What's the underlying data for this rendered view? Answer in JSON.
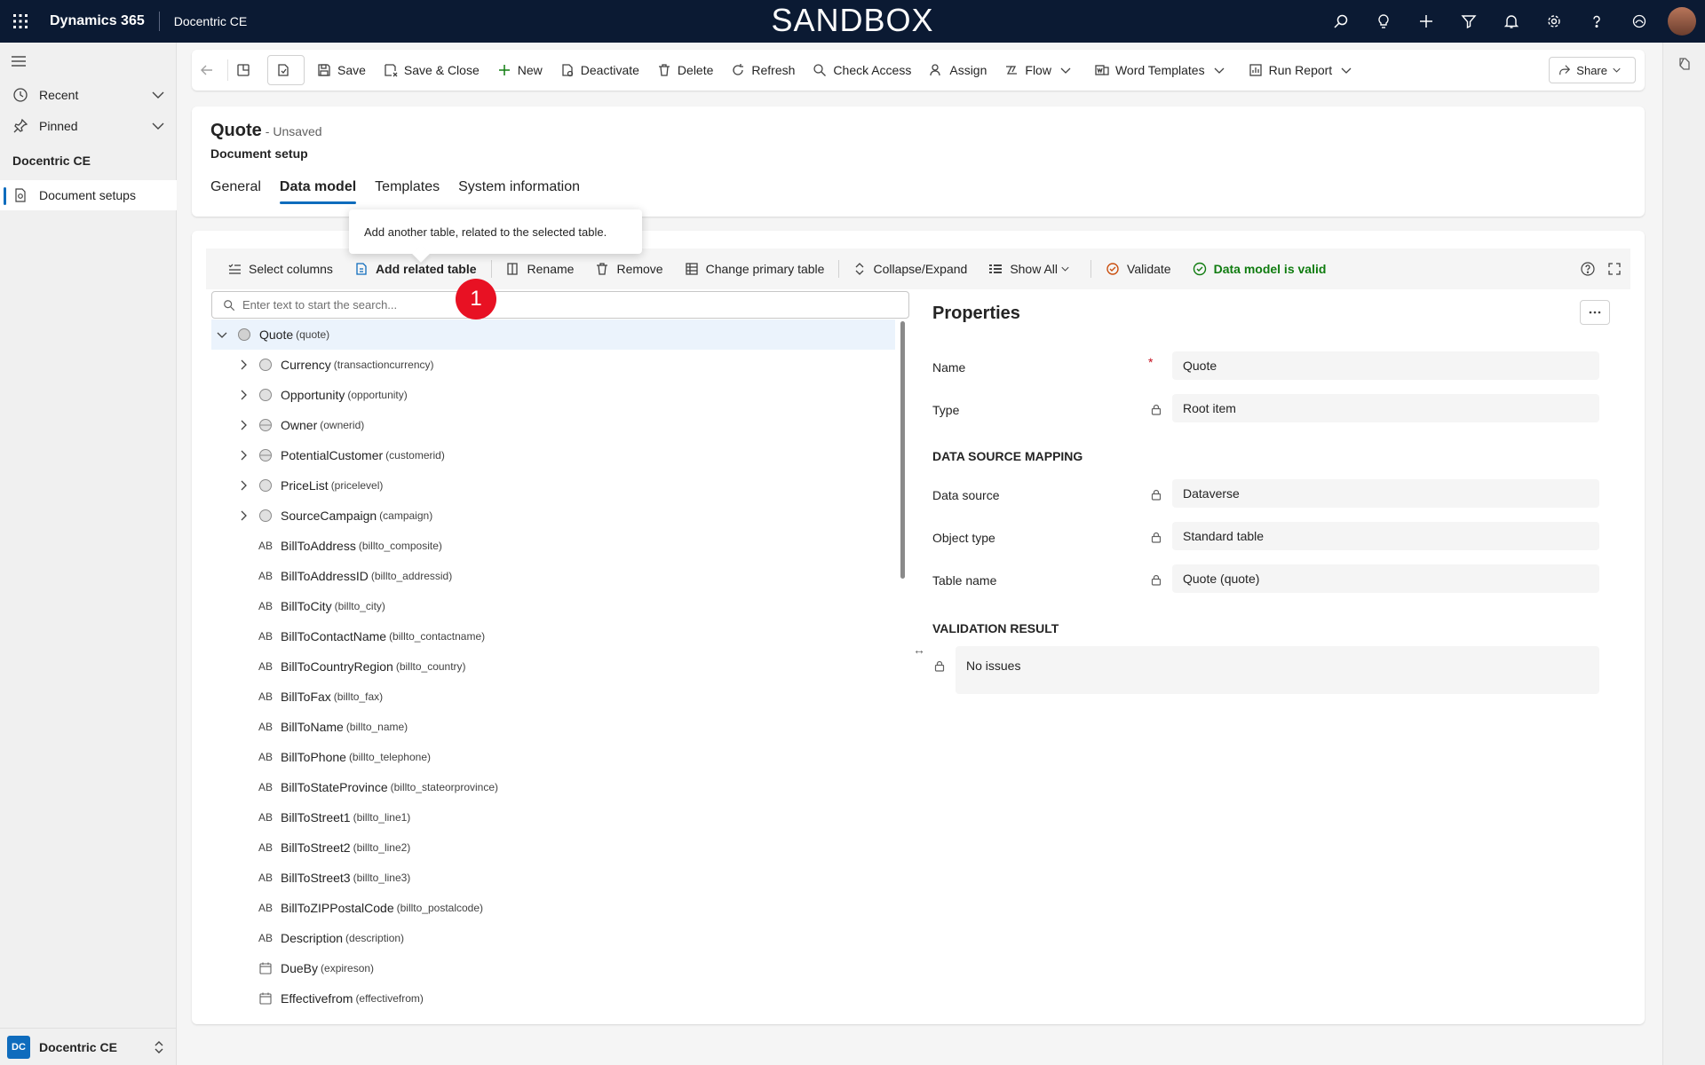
{
  "topbar": {
    "app_name": "Dynamics 365",
    "env_name": "Docentric CE",
    "sandbox_label": "SANDBOX"
  },
  "nav": {
    "recent": "Recent",
    "pinned": "Pinned",
    "group_title": "Docentric CE",
    "items": [
      {
        "label": "Document setups"
      }
    ],
    "area_badge": "DC",
    "area_label": "Docentric CE"
  },
  "commandbar": {
    "save": "Save",
    "save_close": "Save & Close",
    "new": "New",
    "deactivate": "Deactivate",
    "delete": "Delete",
    "refresh": "Refresh",
    "check_access": "Check Access",
    "assign": "Assign",
    "flow": "Flow",
    "word_templates": "Word Templates",
    "run_report": "Run Report",
    "share": "Share"
  },
  "header": {
    "title": "Quote",
    "status": "- Unsaved",
    "subtitle": "Document setup",
    "tabs": [
      {
        "label": "General"
      },
      {
        "label": "Data model"
      },
      {
        "label": "Templates"
      },
      {
        "label": "System information"
      }
    ]
  },
  "tooltip": "Add another table, related to the selected table.",
  "step_badge": "1",
  "dm_toolbar": {
    "select_columns": "Select columns",
    "add_related_table": "Add related table",
    "rename": "Rename",
    "remove": "Remove",
    "change_primary_table": "Change primary table",
    "collapse_expand": "Collapse/Expand",
    "show_all": "Show All",
    "validate": "Validate",
    "data_model_valid": "Data model is valid"
  },
  "search": {
    "placeholder": "Enter text to start the search..."
  },
  "tree": {
    "root": {
      "name": "Quote",
      "sys": "(quote)"
    },
    "relations": [
      {
        "name": "Currency",
        "sys": "(transactioncurrency)",
        "icon": "table-icon"
      },
      {
        "name": "Opportunity",
        "sys": "(opportunity)",
        "icon": "table-icon"
      },
      {
        "name": "Owner",
        "sys": "(ownerid)",
        "icon": "polymorphic-table-icon"
      },
      {
        "name": "PotentialCustomer",
        "sys": "(customerid)",
        "icon": "polymorphic-table-icon"
      },
      {
        "name": "PriceList",
        "sys": "(pricelevel)",
        "icon": "table-icon"
      },
      {
        "name": "SourceCampaign",
        "sys": "(campaign)",
        "icon": "table-icon"
      }
    ],
    "fields": [
      {
        "name": "BillToAddress",
        "sys": "(billto_composite)",
        "icon": "AB"
      },
      {
        "name": "BillToAddressID",
        "sys": "(billto_addressid)",
        "icon": "AB"
      },
      {
        "name": "BillToCity",
        "sys": "(billto_city)",
        "icon": "AB"
      },
      {
        "name": "BillToContactName",
        "sys": "(billto_contactname)",
        "icon": "AB"
      },
      {
        "name": "BillToCountryRegion",
        "sys": "(billto_country)",
        "icon": "AB"
      },
      {
        "name": "BillToFax",
        "sys": "(billto_fax)",
        "icon": "AB"
      },
      {
        "name": "BillToName",
        "sys": "(billto_name)",
        "icon": "AB"
      },
      {
        "name": "BillToPhone",
        "sys": "(billto_telephone)",
        "icon": "AB"
      },
      {
        "name": "BillToStateProvince",
        "sys": "(billto_stateorprovince)",
        "icon": "AB"
      },
      {
        "name": "BillToStreet1",
        "sys": "(billto_line1)",
        "icon": "AB"
      },
      {
        "name": "BillToStreet2",
        "sys": "(billto_line2)",
        "icon": "AB"
      },
      {
        "name": "BillToStreet3",
        "sys": "(billto_line3)",
        "icon": "AB"
      },
      {
        "name": "BillToZIPPostalCode",
        "sys": "(billto_postalcode)",
        "icon": "AB"
      },
      {
        "name": "Description",
        "sys": "(description)",
        "icon": "AB"
      },
      {
        "name": "DueBy",
        "sys": "(expireson)",
        "icon": "calendar"
      },
      {
        "name": "Effectivefrom",
        "sys": "(effectivefrom)",
        "icon": "calendar"
      }
    ]
  },
  "properties": {
    "title": "Properties",
    "name_label": "Name",
    "name_value": "Quote",
    "required_mark": "*",
    "type_label": "Type",
    "type_value": "Root item",
    "mapping_section": "DATA SOURCE MAPPING",
    "datasource_label": "Data source",
    "datasource_value": "Dataverse",
    "objecttype_label": "Object type",
    "objecttype_value": "Standard table",
    "tablename_label": "Table name",
    "tablename_value": "Quote (quote)",
    "validation_section": "VALIDATION RESULT",
    "validation_value": "No issues"
  },
  "colors": {
    "topbar": "#0b1a33",
    "accent": "#0f6cbd",
    "valid": "#107c10",
    "badge": "#e81123"
  }
}
